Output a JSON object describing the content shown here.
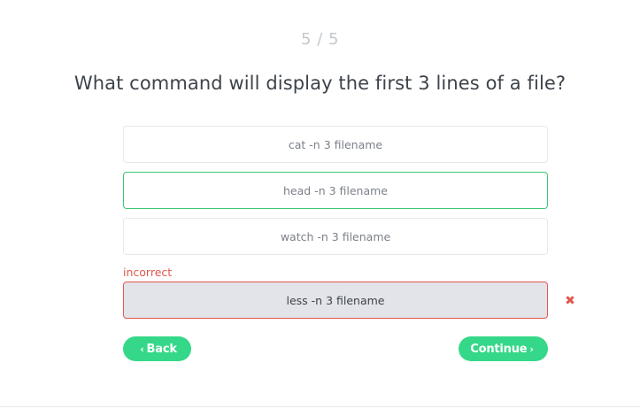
{
  "quiz": {
    "progress": "5 / 5",
    "question": "What command will display the first 3 lines of a file?",
    "options": [
      {
        "label": "cat -n 3 filename",
        "state": "default"
      },
      {
        "label": "head -n 3 filename",
        "state": "correct"
      },
      {
        "label": "watch -n 3 filename",
        "state": "default"
      },
      {
        "label": "less -n 3 filename",
        "state": "incorrect"
      }
    ],
    "incorrect_label": "incorrect",
    "wrong_mark_icon": "close-x-icon"
  },
  "nav": {
    "back_label": "Back",
    "back_icon": "chevron-left-icon",
    "continue_label": "Continue",
    "continue_icon": "chevron-right-icon"
  },
  "colors": {
    "accent_green": "#35d888",
    "correct_border": "#3cc874",
    "error_red": "#e2574c",
    "selected_wrong_bg": "#e3e4e9",
    "question_text": "#3d434b"
  }
}
